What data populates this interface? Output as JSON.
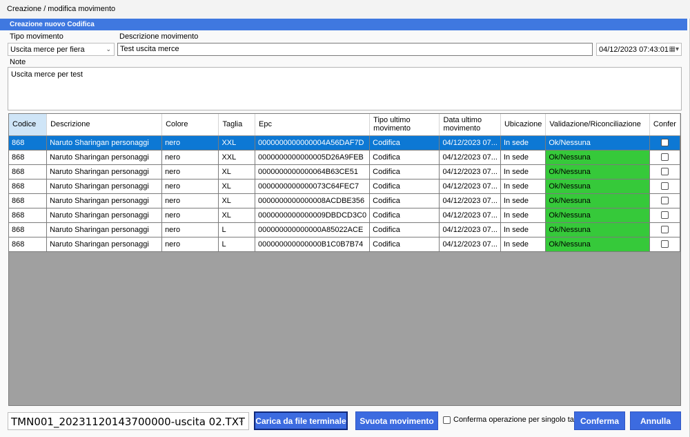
{
  "window": {
    "title": "Creazione / modifica movimento"
  },
  "banner": {
    "title": "Creazione nuovo Codifica"
  },
  "form": {
    "tipo_label": "Tipo movimento",
    "tipo_value": "Uscita merce per fiera",
    "descrizione_label": "Descrizione movimento",
    "descrizione_value": "Test uscita merce",
    "datetime_value": "04/12/2023 07:43:01",
    "note_label": "Note",
    "note_value": "Uscita merce per test"
  },
  "grid": {
    "columns": [
      "Codice",
      "Descrizione",
      "Colore",
      "Taglia",
      "Epc",
      "Tipo ultimo movimento",
      "Data ultimo movimento",
      "Ubicazione",
      "Validazione/Riconciliazione",
      "Confer"
    ],
    "rows": [
      [
        "868",
        "Naruto Sharingan personaggi",
        "nero",
        "XXL",
        "0000000000000004A56DAF7D",
        "Codifica",
        "04/12/2023 07...",
        "In sede",
        "Ok/Nessuna"
      ],
      [
        "868",
        "Naruto Sharingan personaggi",
        "nero",
        "XXL",
        "0000000000000005D26A9FEB",
        "Codifica",
        "04/12/2023 07...",
        "In sede",
        "Ok/Nessuna"
      ],
      [
        "868",
        "Naruto Sharingan personaggi",
        "nero",
        "XL",
        "0000000000000064B63CE51",
        "Codifica",
        "04/12/2023 07...",
        "In sede",
        "Ok/Nessuna"
      ],
      [
        "868",
        "Naruto Sharingan personaggi",
        "nero",
        "XL",
        "0000000000000073C64FEC7",
        "Codifica",
        "04/12/2023 07...",
        "In sede",
        "Ok/Nessuna"
      ],
      [
        "868",
        "Naruto Sharingan personaggi",
        "nero",
        "XL",
        "0000000000000008ACDBE356",
        "Codifica",
        "04/12/2023 07...",
        "In sede",
        "Ok/Nessuna"
      ],
      [
        "868",
        "Naruto Sharingan personaggi",
        "nero",
        "XL",
        "0000000000000009DBDCD3C0",
        "Codifica",
        "04/12/2023 07...",
        "In sede",
        "Ok/Nessuna"
      ],
      [
        "868",
        "Naruto Sharingan personaggi",
        "nero",
        "L",
        "000000000000000A85022ACE",
        "Codifica",
        "04/12/2023 07...",
        "In sede",
        "Ok/Nessuna"
      ],
      [
        "868",
        "Naruto Sharingan personaggi",
        "nero",
        "L",
        "000000000000000B1C0B7B74",
        "Codifica",
        "04/12/2023 07...",
        "In sede",
        "Ok/Nessuna"
      ]
    ],
    "selected_row": 0
  },
  "footer": {
    "file_value": "TMN001_20231120143700000-uscita 02.TXT",
    "load_button": "Carica da file terminale",
    "empty_button": "Svuota movimento",
    "single_tag_label": "Conferma operazione per singolo tag",
    "confirm_button": "Conferma",
    "cancel_button": "Annulla"
  },
  "colors": {
    "accent": "#3c6be0",
    "banner": "#3f78e0",
    "ok_green": "#36c93a",
    "selection": "#0d78d4"
  },
  "icons": {
    "dropdown": "chevron-down-icon",
    "calendar": "calendar-icon"
  }
}
